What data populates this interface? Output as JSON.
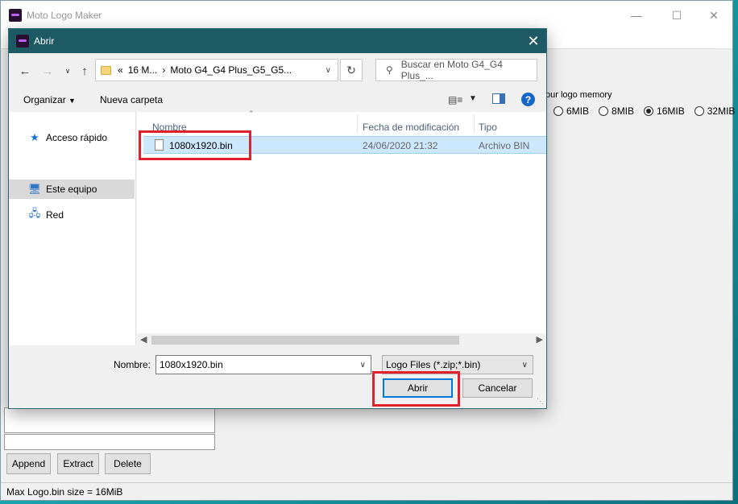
{
  "app": {
    "title": "Moto Logo Maker",
    "memory_legend": "our logo memory",
    "memory_options": [
      {
        "label": "6MIB",
        "selected": false
      },
      {
        "label": "8MIB",
        "selected": false
      },
      {
        "label": "16MIB",
        "selected": true
      },
      {
        "label": "32MIB",
        "selected": false
      }
    ],
    "buttons": {
      "append": "Append",
      "extract": "Extract",
      "delete": "Delete"
    },
    "status": "Max Logo.bin size = 16MiB"
  },
  "dialog": {
    "title": "Abrir",
    "address": {
      "overflow": "«",
      "crumbs": [
        "16 M...",
        "Moto G4_G4 Plus_G5_G5..."
      ]
    },
    "search_placeholder": "Buscar en Moto G4_G4 Plus_...",
    "toolbar": {
      "organize": "Organizar",
      "new_folder": "Nueva carpeta"
    },
    "nav": [
      {
        "label": "Acceso rápido",
        "icon": "star-icon",
        "selected": false
      },
      {
        "label": "Este equipo",
        "icon": "computer-icon",
        "selected": true
      },
      {
        "label": "Red",
        "icon": "network-icon",
        "selected": false
      }
    ],
    "columns": {
      "name": "Nombre",
      "date": "Fecha de modificación",
      "type": "Tipo"
    },
    "files": [
      {
        "name": "1080x1920.bin",
        "date": "24/06/2020 21:32",
        "type": "Archivo BIN"
      }
    ],
    "filename_label": "Nombre:",
    "filename_value": "1080x1920.bin",
    "filetype": "Logo Files (*.zip;*.bin)",
    "open_label": "Abrir",
    "cancel_label": "Cancelar"
  },
  "colors": {
    "dialog_title_bg": "#1d5a63",
    "selection": "#cce8ff",
    "highlight": "#e0212b",
    "accent": "#0078d7"
  }
}
